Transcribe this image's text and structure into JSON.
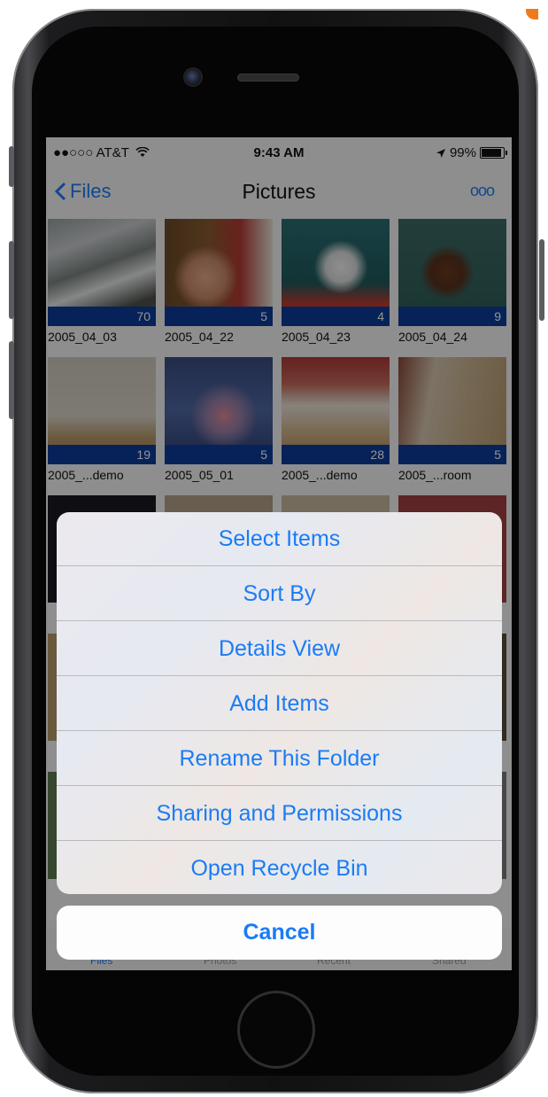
{
  "status_bar": {
    "carrier": "●●○○○ AT&T",
    "time": "9:43 AM",
    "battery": "99%"
  },
  "nav": {
    "back_label": "Files",
    "title": "Pictures",
    "more_label": "ooo"
  },
  "folders": [
    {
      "name": "2005_04_03",
      "count": "70"
    },
    {
      "name": "2005_04_22",
      "count": "5"
    },
    {
      "name": "2005_04_23",
      "count": "4"
    },
    {
      "name": "2005_04_24",
      "count": "9"
    },
    {
      "name": "2005_...demo",
      "count": "19"
    },
    {
      "name": "2005_05_01",
      "count": "5"
    },
    {
      "name": "2005_...demo",
      "count": "28"
    },
    {
      "name": "2005_...room",
      "count": "5"
    }
  ],
  "tabs": [
    "Files",
    "Photos",
    "Recent",
    "Shared"
  ],
  "action_sheet": {
    "items": [
      "Select Items",
      "Sort By",
      "Details View",
      "Add Items",
      "Rename This Folder",
      "Sharing and Permissions",
      "Open Recycle Bin"
    ],
    "cancel": "Cancel"
  },
  "colors": {
    "accent": "#1a7cf5",
    "count_bar": "#0c3c99"
  }
}
